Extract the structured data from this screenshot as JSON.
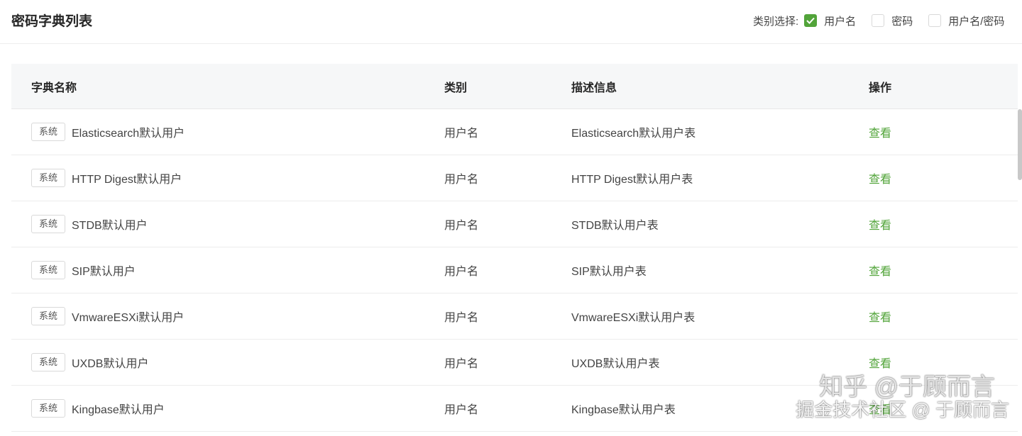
{
  "page_title": "密码字典列表",
  "filter": {
    "label": "类别选择:",
    "options": [
      {
        "label": "用户名",
        "checked": true
      },
      {
        "label": "密码",
        "checked": false
      },
      {
        "label": "用户名/密码",
        "checked": false
      }
    ]
  },
  "table": {
    "headers": [
      "字典名称",
      "类别",
      "描述信息",
      "操作"
    ],
    "rows": [
      {
        "tag": "系统",
        "name": "Elasticsearch默认用户",
        "type": "用户名",
        "desc": "Elasticsearch默认用户表",
        "action": "查看"
      },
      {
        "tag": "系统",
        "name": "HTTP Digest默认用户",
        "type": "用户名",
        "desc": "HTTP Digest默认用户表",
        "action": "查看"
      },
      {
        "tag": "系统",
        "name": "STDB默认用户",
        "type": "用户名",
        "desc": "STDB默认用户表",
        "action": "查看"
      },
      {
        "tag": "系统",
        "name": "SIP默认用户",
        "type": "用户名",
        "desc": "SIP默认用户表",
        "action": "查看"
      },
      {
        "tag": "系统",
        "name": "VmwareESXi默认用户",
        "type": "用户名",
        "desc": "VmwareESXi默认用户表",
        "action": "查看"
      },
      {
        "tag": "系统",
        "name": "UXDB默认用户",
        "type": "用户名",
        "desc": "UXDB默认用户表",
        "action": "查看"
      },
      {
        "tag": "系统",
        "name": "Kingbase默认用户",
        "type": "用户名",
        "desc": "Kingbase默认用户表",
        "action": "查看"
      }
    ]
  },
  "watermark": {
    "line1": "知乎 @于顾而言",
    "line2": "掘金技术社区 @ 于顾而言"
  },
  "colors": {
    "accent": "#52a43a",
    "header_bg": "#f6f7f8"
  }
}
